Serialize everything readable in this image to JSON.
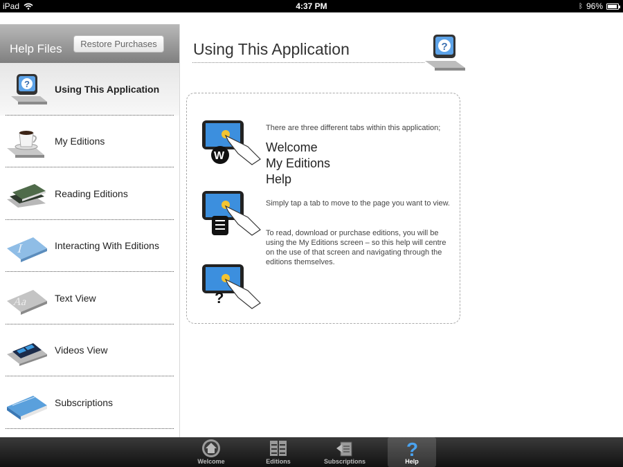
{
  "status_bar": {
    "device": "iPad",
    "time": "4:37 PM",
    "battery": "96%",
    "battery_level": 0.96
  },
  "sidebar": {
    "title": "Help Files",
    "restore_label": "Restore Purchases",
    "items": [
      {
        "label": "Using This Application",
        "icon": "help-question-icon",
        "selected": true
      },
      {
        "label": "My Editions",
        "icon": "coffee-cup-icon"
      },
      {
        "label": "Reading Editions",
        "icon": "books-icon"
      },
      {
        "label": "Interacting With Editions",
        "icon": "info-letter-icon"
      },
      {
        "label": "Text View",
        "icon": "text-aa-icon"
      },
      {
        "label": "Videos View",
        "icon": "film-strip-icon"
      },
      {
        "label": "Subscriptions",
        "icon": "blue-book-icon"
      }
    ]
  },
  "main": {
    "title": "Using This Application",
    "intro": "There are three different tabs within this application;",
    "tabs": [
      "Welcome",
      "My Editions",
      "Help"
    ],
    "tap_text": "Simply tap a tab to move to the page you want to view.",
    "read_text": "To read, download or purchase editions, you will be using the My Editions screen – so this help will centre on the use of that screen and navigating through the editions themselves."
  },
  "tab_bar": {
    "tabs": [
      {
        "label": "Welcome",
        "icon": "home-icon"
      },
      {
        "label": "Editions",
        "icon": "editions-icon"
      },
      {
        "label": "Subscriptions",
        "icon": "subscriptions-icon"
      },
      {
        "label": "Help",
        "icon": "question-mark-icon",
        "selected": true
      }
    ]
  },
  "colors": {
    "accent_blue": "#3a8ee6",
    "header_gray": "#8f8f8f"
  }
}
